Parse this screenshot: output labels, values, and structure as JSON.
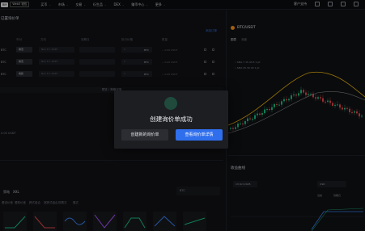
{
  "topbar": {
    "logo_a": "BM",
    "logo_b": "Web3 钱包",
    "nav": [
      "买币",
      "市场",
      "交易",
      "衍生品",
      "DEX",
      "赚币中心",
      "更多"
    ],
    "right": [
      "客户支持",
      "下载"
    ]
  },
  "left": {
    "title": "已置询价单",
    "link": "添加订单",
    "columns": [
      "币对",
      "方向",
      "到期日",
      "执行价格",
      "数量",
      "价格"
    ],
    "rows": [
      {
        "pair": "BTC",
        "side": "看涨",
        "date": "Nov 17, 2025",
        "qty": "1",
        "unit": "BTC",
        "price": "~ 0.00 USDT"
      },
      {
        "pair": "BTC",
        "side": "看涨",
        "date": "Nov 17, 2025",
        "qty": "1",
        "unit": "BTC",
        "price": "~ 0.00 USDT"
      },
      {
        "pair": "BTC",
        "side": "看跌",
        "date": "Nov 17, 2025",
        "qty": "1",
        "unit": "BTC",
        "price": "~ 0.00 USDT"
      }
    ],
    "section_label": "预览 / 策略详情",
    "side_label": "0.00 USDT",
    "bottom": {
      "tabs": [
        "策略",
        "XXL"
      ],
      "strategy_labels": [
        "看涨价差",
        "看跌价差",
        "跨式组合",
        "宽跨式组合",
        "铁鹰式",
        "蝶式"
      ],
      "field": "BTC"
    }
  },
  "right": {
    "pair": "BTC/USDT",
    "sub_tabs": [
      "图表",
      "深度"
    ],
    "ma_line1": "• SMA 7 15 43.5 1 pt",
    "ma_line2": "• SMA 25 30 43 1 pt",
    "bottom_title": "收益曲线",
    "date": "13 Oct 2025",
    "toggle_label": "USD",
    "legend": [
      "当前",
      "到期日"
    ]
  },
  "modal": {
    "title": "创建询价单成功",
    "btn_secondary": "创建新的询价单",
    "btn_primary": "查看询价单详情"
  },
  "colors": {
    "accent": "#2f6fed",
    "up": "#1bbf83",
    "down": "#e5484d",
    "btc": "#f7931a"
  }
}
